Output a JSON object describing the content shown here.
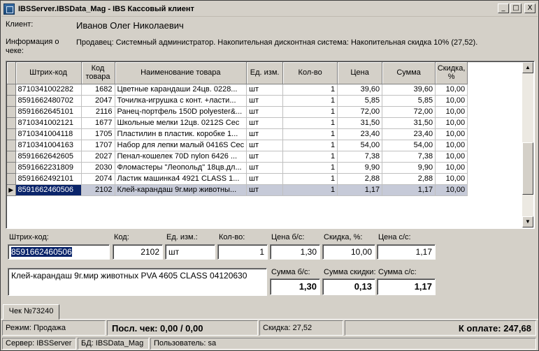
{
  "window": {
    "title": "IBSServer.IBSData_Mag - IBS Кассовый клиент",
    "min_glyph": "_",
    "max_glyph": "□",
    "close_glyph": "X"
  },
  "header": {
    "client_label": "Клиент:",
    "client_value": "Иванов Олег Николаевич",
    "info_label": "Информация о чеке:",
    "info_value": "Продавец: Системный администратор. Накопительная дисконтная система: Накопительная скидка 10% (27,52)."
  },
  "grid": {
    "columns": [
      "Штрих-код",
      "Код товара",
      "Наименование товара",
      "Ед. изм.",
      "Кол-во",
      "Цена",
      "Сумма",
      "Скидка, %"
    ],
    "rows": [
      [
        "8710341002282",
        "1682",
        "Цветные  карандаши 24цв. 0228...",
        "шт",
        "1",
        "39,60",
        "39,60",
        "10,00"
      ],
      [
        "8591662480702",
        "2047",
        "Точилка-игрушка с конт. +ласти...",
        "шт",
        "1",
        "5,85",
        "5,85",
        "10,00"
      ],
      [
        "8591662645101",
        "2116",
        "Ранец-портфель 150D polyester&...",
        "шт",
        "1",
        "72,00",
        "72,00",
        "10,00"
      ],
      [
        "8710341002121",
        "1677",
        "Школьные  мелки 12цв. 0212S Cec",
        "шт",
        "1",
        "31,50",
        "31,50",
        "10,00"
      ],
      [
        "8710341004118",
        "1705",
        "Пластилин в пластик. коробке 1...",
        "шт",
        "1",
        "23,40",
        "23,40",
        "10,00"
      ],
      [
        "8710341004163",
        "1707",
        "Набор для лепки малый  0416S Cec",
        "шт",
        "1",
        "54,00",
        "54,00",
        "10,00"
      ],
      [
        "8591662642605",
        "2027",
        "Пенал-кошелек 70D nylon  6426 ...",
        "шт",
        "1",
        "7,38",
        "7,38",
        "10,00"
      ],
      [
        "8591662231809",
        "2030",
        "Фломастеры \"Леопольд\" 18цв.дл...",
        "шт",
        "1",
        "9,90",
        "9,90",
        "10,00"
      ],
      [
        "8591662492101",
        "2074",
        "Ластик  машинка4  4921  CLASS 1...",
        "шт",
        "1",
        "2,88",
        "2,88",
        "10,00"
      ],
      [
        "8591662460506",
        "2102",
        "Клей-карандаш 9г.мир животны...",
        "шт",
        "1",
        "1,17",
        "1,17",
        "10,00"
      ]
    ],
    "selected_row": 9
  },
  "form": {
    "barcode_label": "Штрих-код:",
    "barcode_value": "8591662460506",
    "code_label": "Код:",
    "code_value": "2102",
    "unit_label": "Ед. изм.:",
    "unit_value": "шт",
    "qty_label": "Кол-во:",
    "qty_value": "1",
    "price_nodisc_label": "Цена б/с:",
    "price_nodisc_value": "1,30",
    "discount_label": "Скидка, %:",
    "discount_value": "10,00",
    "price_disc_label": "Цена с/с:",
    "price_disc_value": "1,17",
    "description": "Клей-карандаш 9г.мир животных PVA  4605  CLASS 04120630",
    "sum_nodisc_label": "Сумма б/с:",
    "sum_nodisc_value": "1,30",
    "sum_discount_label": "Сумма скидки:",
    "sum_discount_value": "0,13",
    "sum_disc_label": "Сумма с/с:",
    "sum_disc_value": "1,17"
  },
  "tabs": [
    {
      "label": "Чек №73240"
    }
  ],
  "status": {
    "mode": "Режим: Продажа",
    "last_check": "Посл. чек: 0,00 / 0,00",
    "discount": "Скидка: 27,52",
    "to_pay": "К оплате: 247,68",
    "server": "Сервер: IBSServer",
    "db": "БД: IBSData_Mag",
    "user": "Пользователь: sa"
  }
}
